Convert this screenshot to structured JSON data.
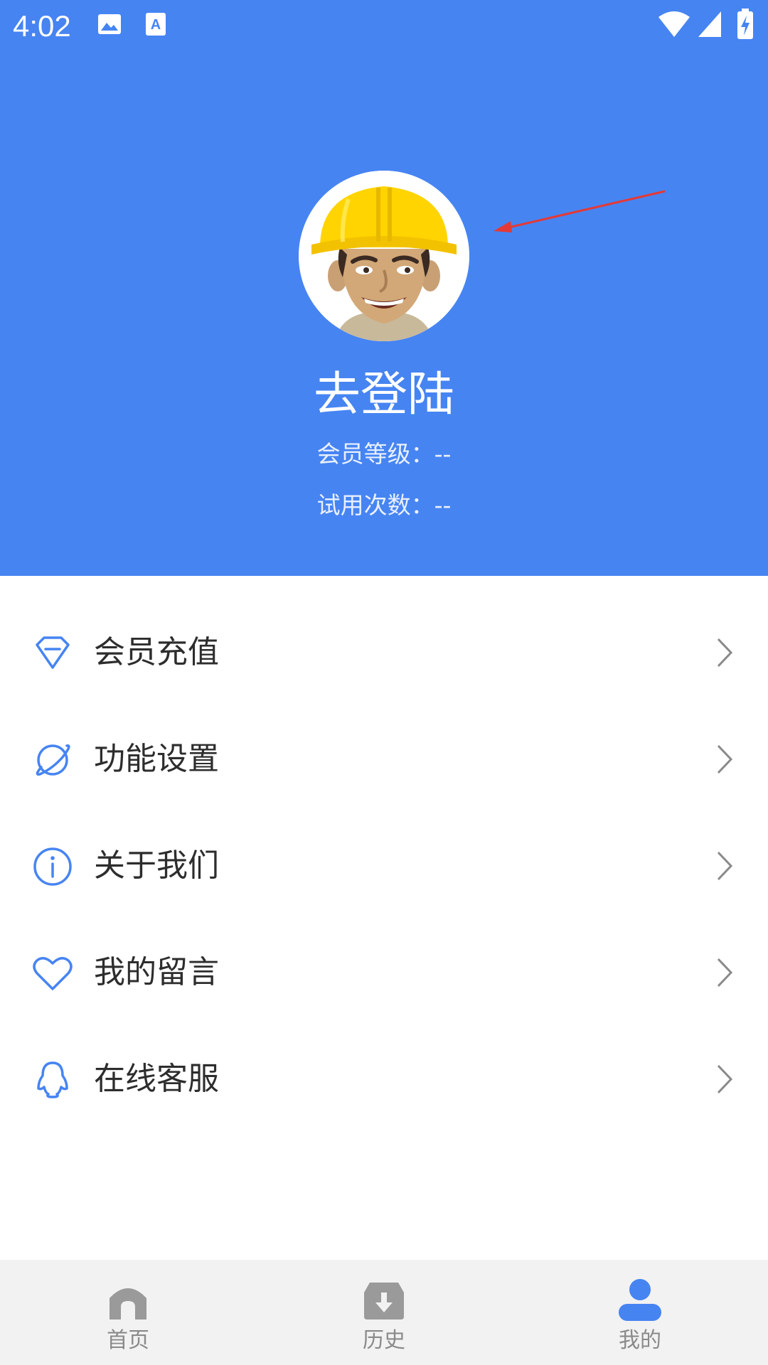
{
  "status_bar": {
    "time": "4:02",
    "icons": [
      "image-icon",
      "text-a-icon",
      "wifi-icon",
      "signal-icon",
      "battery-charging-icon"
    ]
  },
  "profile": {
    "login_title": "去登陆",
    "member_level": "会员等级：--",
    "trial_count": "试用次数：--",
    "avatar_icon": "construction-worker-avatar"
  },
  "colors": {
    "primary": "#4684f2",
    "annotation_arrow": "#e53935"
  },
  "menu": {
    "items": [
      {
        "label": "会员充值",
        "icon": "diamond-icon"
      },
      {
        "label": "功能设置",
        "icon": "planet-icon"
      },
      {
        "label": "关于我们",
        "icon": "info-icon"
      },
      {
        "label": "我的留言",
        "icon": "heart-icon"
      },
      {
        "label": "在线客服",
        "icon": "qq-penguin-icon"
      }
    ]
  },
  "tabbar": {
    "tabs": [
      {
        "label": "首页",
        "icon": "home-icon",
        "active": false
      },
      {
        "label": "历史",
        "icon": "download-box-icon",
        "active": false
      },
      {
        "label": "我的",
        "icon": "person-icon",
        "active": true
      }
    ]
  }
}
